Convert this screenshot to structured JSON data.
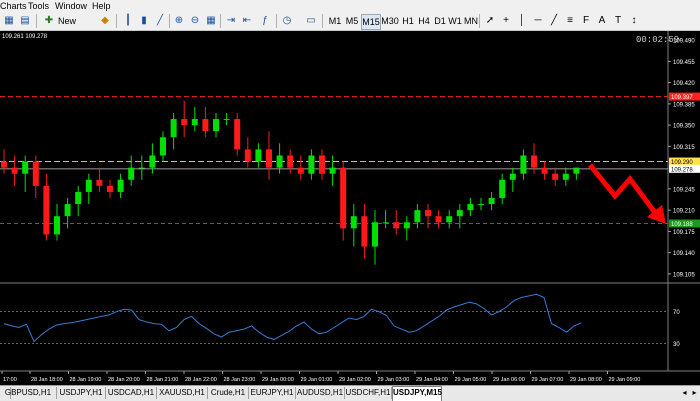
{
  "menu": [
    "Charts",
    "Tools",
    "Window",
    "Help"
  ],
  "toolbar": {
    "new_order": "New Order",
    "timeframes": [
      "M1",
      "M5",
      "M15",
      "M30",
      "H1",
      "H4",
      "D1",
      "W1",
      "MN"
    ]
  },
  "chart": {
    "bid_ask": "109.261 109.278",
    "countdown": "00:02:59",
    "price_ticks": [
      "109.490",
      "109.455",
      "109.420",
      "109.385",
      "109.350",
      "109.315",
      "109.245",
      "109.210",
      "109.175",
      "109.140",
      "109.105"
    ],
    "price_labels": {
      "red": "109.397",
      "yellow": "109.290",
      "white": "109.278",
      "green": "109.188"
    },
    "time_labels": [
      "17:00",
      "28 Jan 18:00",
      "28 Jan 19:00",
      "28 Jan 20:00",
      "28 Jan 21:00",
      "28 Jan 22:00",
      "28 Jan 23:00",
      "29 Jan 00:00",
      "29 Jan 01:00",
      "29 Jan 02:00",
      "29 Jan 03:00",
      "29 Jan 04:00",
      "29 Jan 05:00",
      "29 Jan 06:00",
      "29 Jan 07:00",
      "29 Jan 08:00",
      "29 Jan 09:00"
    ],
    "rsi_ticks": [
      "70",
      "30"
    ],
    "colors": {
      "bull": "#00e000",
      "bear": "#ff1a1a",
      "rsi": "#3a7bd5",
      "red_line": "#ff2020",
      "yellow_line": "#ffe14d",
      "green_line": "#20c020",
      "arrow": "#ff0000"
    }
  },
  "chart_data": {
    "type": "candlestick",
    "symbol": "USDJPY",
    "timeframe": "M15",
    "ylim": [
      109.09,
      109.505
    ],
    "candles": [
      [
        109.29,
        109.31,
        109.27,
        109.28
      ],
      [
        109.28,
        109.3,
        109.25,
        109.27
      ],
      [
        109.27,
        109.3,
        109.24,
        109.29
      ],
      [
        109.29,
        109.3,
        109.23,
        109.25
      ],
      [
        109.25,
        109.27,
        109.16,
        109.17
      ],
      [
        109.17,
        109.22,
        109.16,
        109.2
      ],
      [
        109.2,
        109.23,
        109.18,
        109.22
      ],
      [
        109.22,
        109.25,
        109.2,
        109.24
      ],
      [
        109.24,
        109.27,
        109.22,
        109.26
      ],
      [
        109.26,
        109.28,
        109.24,
        109.25
      ],
      [
        109.25,
        109.26,
        109.23,
        109.24
      ],
      [
        109.24,
        109.27,
        109.23,
        109.26
      ],
      [
        109.26,
        109.3,
        109.25,
        109.28
      ],
      [
        109.28,
        109.3,
        109.26,
        109.28
      ],
      [
        109.28,
        109.32,
        109.27,
        109.3
      ],
      [
        109.3,
        109.34,
        109.29,
        109.33
      ],
      [
        109.33,
        109.37,
        109.31,
        109.36
      ],
      [
        109.36,
        109.39,
        109.33,
        109.35
      ],
      [
        109.35,
        109.38,
        109.34,
        109.36
      ],
      [
        109.36,
        109.38,
        109.33,
        109.34
      ],
      [
        109.34,
        109.37,
        109.33,
        109.36
      ],
      [
        109.36,
        109.37,
        109.35,
        109.36
      ],
      [
        109.36,
        109.37,
        109.3,
        109.31
      ],
      [
        109.31,
        109.33,
        109.28,
        109.29
      ],
      [
        109.29,
        109.32,
        109.28,
        109.31
      ],
      [
        109.31,
        109.34,
        109.26,
        109.28
      ],
      [
        109.28,
        109.32,
        109.27,
        109.3
      ],
      [
        109.3,
        109.31,
        109.27,
        109.28
      ],
      [
        109.28,
        109.3,
        109.26,
        109.27
      ],
      [
        109.27,
        109.31,
        109.26,
        109.3
      ],
      [
        109.3,
        109.31,
        109.26,
        109.27
      ],
      [
        109.27,
        109.3,
        109.25,
        109.28
      ],
      [
        109.28,
        109.29,
        109.16,
        109.18
      ],
      [
        109.18,
        109.22,
        109.15,
        109.2
      ],
      [
        109.2,
        109.22,
        109.13,
        109.15
      ],
      [
        109.15,
        109.21,
        109.12,
        109.19
      ],
      [
        109.19,
        109.21,
        109.18,
        109.19
      ],
      [
        109.19,
        109.21,
        109.17,
        109.18
      ],
      [
        109.18,
        109.2,
        109.16,
        109.19
      ],
      [
        109.19,
        109.22,
        109.18,
        109.21
      ],
      [
        109.21,
        109.22,
        109.18,
        109.2
      ],
      [
        109.2,
        109.21,
        109.18,
        109.19
      ],
      [
        109.19,
        109.21,
        109.18,
        109.2
      ],
      [
        109.2,
        109.22,
        109.18,
        109.21
      ],
      [
        109.21,
        109.23,
        109.2,
        109.22
      ],
      [
        109.22,
        109.23,
        109.21,
        109.22
      ],
      [
        109.22,
        109.24,
        109.21,
        109.23
      ],
      [
        109.23,
        109.27,
        109.22,
        109.26
      ],
      [
        109.26,
        109.28,
        109.24,
        109.27
      ],
      [
        109.27,
        109.31,
        109.26,
        109.3
      ],
      [
        109.3,
        109.32,
        109.27,
        109.28
      ],
      [
        109.28,
        109.29,
        109.26,
        109.27
      ],
      [
        109.27,
        109.28,
        109.25,
        109.26
      ],
      [
        109.26,
        109.28,
        109.25,
        109.27
      ],
      [
        109.27,
        109.28,
        109.26,
        109.28
      ]
    ],
    "rsi": [
      55,
      52,
      50,
      54,
      32,
      41,
      48,
      53,
      55,
      56,
      58,
      60,
      62,
      64,
      66,
      70,
      73,
      72,
      60,
      57,
      55,
      54,
      46,
      50,
      60,
      64,
      55,
      49,
      42,
      38,
      44,
      46,
      48,
      52,
      44,
      38,
      35,
      40,
      45,
      52,
      57,
      48,
      42,
      44,
      50,
      56,
      62,
      60,
      64,
      73,
      70,
      65,
      52,
      48,
      44,
      46,
      52,
      58,
      64,
      72,
      76,
      79,
      82,
      80,
      74,
      66,
      70,
      76,
      84,
      88,
      90,
      92,
      88,
      55,
      50,
      44,
      52,
      56
    ],
    "rsi_levels": [
      70,
      30
    ],
    "levels": {
      "red": 109.397,
      "yellow": 109.29,
      "white": 109.278,
      "green": 109.188
    }
  },
  "tabs": [
    "GBPUSD,H1",
    "USDJPY,H1",
    "USDCAD,H1",
    "XAUUSD,H1",
    "Crude,H1",
    "EURJPY,H1",
    "AUDUSD,H1",
    "USDCHF,H1",
    "USDJPY,M15"
  ],
  "active_tab": "USDJPY,M15"
}
